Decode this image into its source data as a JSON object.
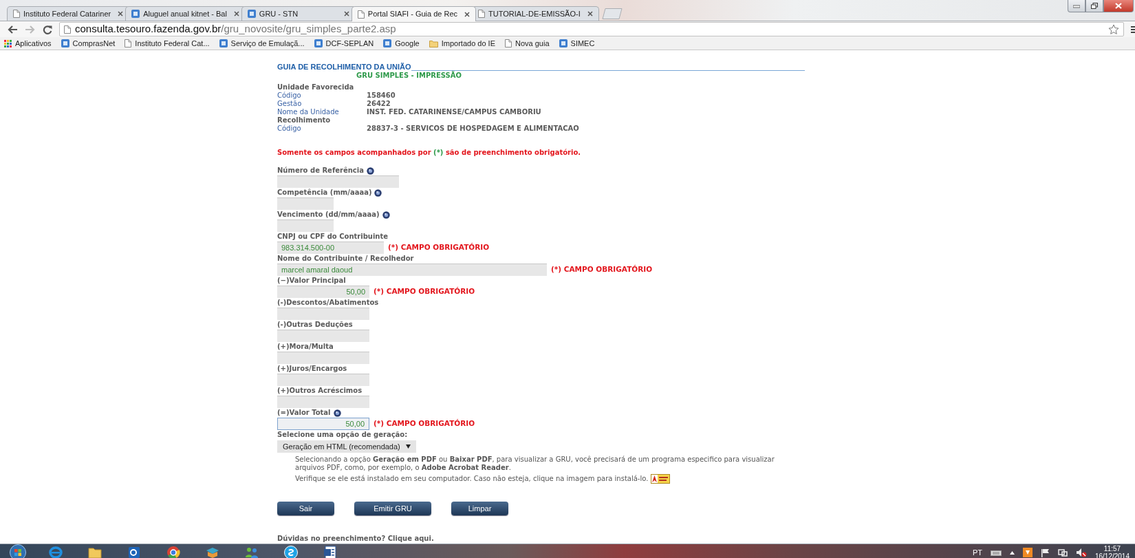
{
  "browser": {
    "tabs": [
      {
        "title": "Instituto Federal Catariner",
        "kind": "page",
        "selected": false
      },
      {
        "title": "Aluguel anual kitnet - Bal",
        "kind": "site",
        "selected": false
      },
      {
        "title": "GRU - STN",
        "kind": "site",
        "selected": false
      },
      {
        "title": "Portal SIAFI - Guia de Rec",
        "kind": "page",
        "selected": true
      },
      {
        "title": "TUTORIAL-DE-EMISSÃO-I",
        "kind": "page",
        "selected": false
      }
    ],
    "address": {
      "host": "consulta.tesouro.fazenda.gov.br",
      "path": "/gru_novosite/gru_simples_parte2.asp"
    },
    "bookmarks": [
      {
        "label": "Aplicativos",
        "kind": "apps"
      },
      {
        "label": "ComprasNet",
        "kind": "site"
      },
      {
        "label": "Instituto Federal Cat...",
        "kind": "page"
      },
      {
        "label": "Serviço de Emulaçã...",
        "kind": "site"
      },
      {
        "label": "DCF-SEPLAN",
        "kind": "site"
      },
      {
        "label": "Google",
        "kind": "site"
      },
      {
        "label": "Importado do IE",
        "kind": "folder"
      },
      {
        "label": "Nova guia",
        "kind": "page"
      },
      {
        "label": "SIMEC",
        "kind": "site"
      }
    ]
  },
  "page": {
    "title": "GUIA DE RECOLHIMENTO DA UNIÃO",
    "subtitle": "GRU SIMPLES - IMPRESSÃO",
    "info": [
      {
        "kind": "heading",
        "label": "Unidade Favorecida"
      },
      {
        "kind": "row",
        "label": "Código",
        "value": "158460"
      },
      {
        "kind": "row",
        "label": "Gestão",
        "value": "26422"
      },
      {
        "kind": "row",
        "label": "Nome da Unidade",
        "value": "INST. FED. CATARINENSE/CAMPUS CAMBORIU"
      },
      {
        "kind": "heading",
        "label": "Recolhimento"
      },
      {
        "kind": "row",
        "label": "Código",
        "value": "28837-3 - SERVICOS DE HOSPEDAGEM E ALIMENTACAO"
      }
    ],
    "notice": {
      "before": "Somente os campos acompanhados por",
      "mark": "(*)",
      "after": "são de preenchimento obrigatório."
    },
    "fields": [
      {
        "label": "Número de Referência",
        "kind": "reference",
        "help": true,
        "focused": false
      },
      {
        "label": "Competência (mm/aaaa)",
        "kind": "date",
        "help": true,
        "focused": false
      },
      {
        "label": "Vencimento (dd/mm/aaaa)",
        "kind": "date",
        "help": true,
        "focused": false
      },
      {
        "label": "CNPJ ou CPF do Contribuinte",
        "kind": "document",
        "help": false,
        "focused": false,
        "value": "983.314.500-00",
        "required_note": "(*) CAMPO OBRIGATÓRIO"
      },
      {
        "label": "Nome do Contribuinte / Recolhedor",
        "kind": "name",
        "help": false,
        "focused": false,
        "value": "marcel amaral daoud",
        "required_note": "(*) CAMPO OBRIGATÓRIO"
      },
      {
        "label": "(−)Valor Principal",
        "kind": "amount",
        "help": false,
        "focused": false,
        "value": "50,00",
        "required_note": "(*) CAMPO OBRIGATÓRIO"
      },
      {
        "label": "(-)Descontos/Abatimentos",
        "kind": "amount",
        "help": false,
        "focused": false
      },
      {
        "label": "(-)Outras Deduções",
        "kind": "amount",
        "help": false,
        "focused": false
      },
      {
        "label": "(+)Mora/Multa",
        "kind": "amount",
        "help": false,
        "focused": false
      },
      {
        "label": "(+)Juros/Encargos",
        "kind": "amount",
        "help": false,
        "focused": false
      },
      {
        "label": "(+)Outros Acréscimos",
        "kind": "amount",
        "help": false,
        "focused": false
      },
      {
        "label": "(=)Valor Total",
        "kind": "amount",
        "help": true,
        "focused": true,
        "value": "50,00",
        "required_note": "(*) CAMPO OBRIGATÓRIO"
      }
    ],
    "generation": {
      "label": "Selecione uma opção de geração:",
      "selected_option": "Geração em HTML (recomendada)"
    },
    "notes": [
      "Selecionando a opção **Geração em PDF** ou **Baixar PDF**, para visualizar a GRU, você precisará de um programa especifico para visualizar arquivos PDF, como, por exemplo, o **Adobe Acrobat Reader**.",
      "Verifique se ele está instalado em seu computador. Caso não esteja, clique na imagem para instalá-lo."
    ],
    "buttons": [
      "Sair",
      "Emitir GRU",
      "Limpar"
    ],
    "help": {
      "text": "Dúvidas no preenchimento?",
      "link": "Clique aqui."
    }
  },
  "taskbar": {
    "language": "PT",
    "time": "11:57",
    "date": "16/12/2014"
  }
}
